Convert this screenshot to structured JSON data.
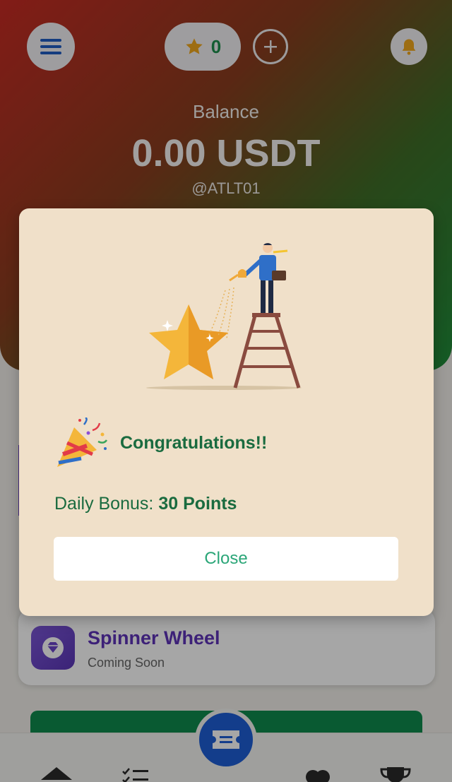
{
  "header": {
    "points_count": "0",
    "balance_label": "Balance",
    "balance_value": "0.00 USDT",
    "username": "@ATLT01"
  },
  "feature_card": {
    "title": "Spinner Wheel",
    "subtitle": "Coming Soon"
  },
  "modal": {
    "heading": "Congratulations!!",
    "bonus_label": "Daily Bonus:",
    "bonus_value": "30 Points",
    "close_label": "Close"
  },
  "colors": {
    "brand_green": "#1a6b3f",
    "accent_purple": "#5e33b9",
    "modal_bg": "#f0e0c9",
    "primary_blue": "#1e5fd6"
  },
  "icons": {
    "menu": "hamburger-icon",
    "points": "star-icon",
    "add": "plus-icon",
    "notifications": "bell-icon",
    "feature": "diamond-icon",
    "celebration": "party-popper-icon",
    "nav": [
      "home-icon",
      "tasks-icon",
      "ticket-icon",
      "coins-icon",
      "trophy-icon"
    ]
  }
}
